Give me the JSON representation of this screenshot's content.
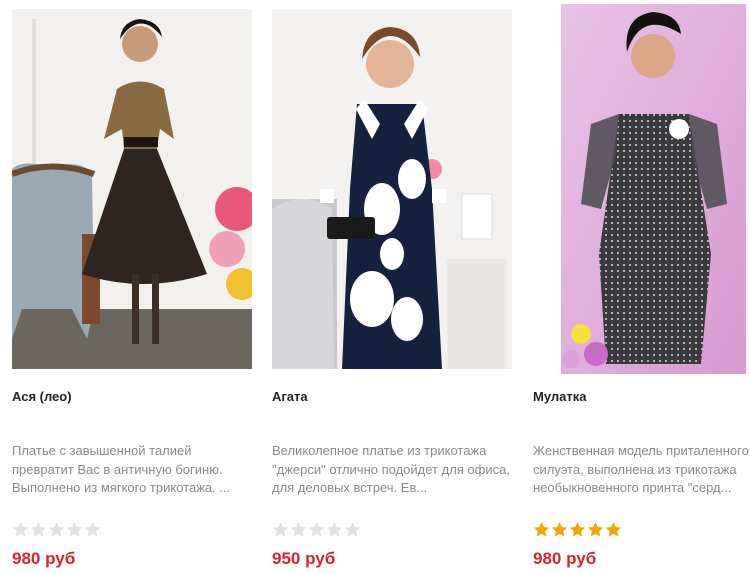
{
  "products": [
    {
      "title": "Ася (лео)",
      "description": "Платье с завышенной талией превратит Вас в античную богиню. Выполнено из мягкого трикотажа. ...",
      "rating": 0,
      "price": "980 руб",
      "image": "woman-leopard-print-dress-photo"
    },
    {
      "title": "Агата",
      "description": "Великолепное платье из трикотажа \"джерси\" отлично подойдет для офиса, для деловых встреч. Ев...",
      "rating": 0,
      "price": "950 руб",
      "image": "woman-navy-floral-dress-photo"
    },
    {
      "title": "Мулатка",
      "description": "Женственная модель приталенного силуэта, выполнена из трикотажа необыкновенного принта \"серд...",
      "rating": 5,
      "price": "980 руб",
      "image": "woman-dotted-grey-dress-photo"
    }
  ],
  "colors": {
    "price": "#d6262b",
    "star_filled": "#f5a400",
    "star_empty": "#e2e2e2",
    "description": "#8a8a8a"
  }
}
